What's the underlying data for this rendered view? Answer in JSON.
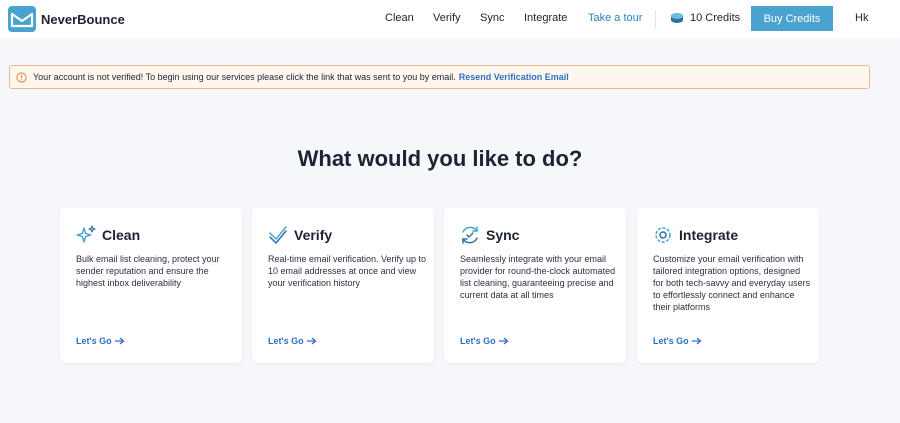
{
  "header": {
    "brand": "NeverBounce",
    "nav": {
      "clean": "Clean",
      "verify": "Verify",
      "sync": "Sync",
      "integrate": "Integrate",
      "tour": "Take a tour"
    },
    "credits": "10 Credits",
    "buy_credits": "Buy Credits",
    "avatar": "Hk"
  },
  "alert": {
    "message": "Your account is not verified! To begin using our services please click the link that was sent to you by email.",
    "link": "Resend Verification Email"
  },
  "main": {
    "heading": "What would you like to do?",
    "cards": [
      {
        "title": "Clean",
        "icon": "sparkle-icon",
        "description": "Bulk email list cleaning, protect your sender reputation and ensure the highest inbox deliverability",
        "link": "Let's Go"
      },
      {
        "title": "Verify",
        "icon": "verify-check-icon",
        "description": "Real-time email verification. Verify up to 10 email addresses at once and view your verification history",
        "link": "Let's Go"
      },
      {
        "title": "Sync",
        "icon": "sync-icon",
        "description": "Seamlessly integrate with your email provider for round-the-clock automated list cleaning, guaranteeing precise and current data at all times",
        "link": "Let's Go"
      },
      {
        "title": "Integrate",
        "icon": "gear-icon",
        "description": "Customize your email verification with tailored integration options, designed for both tech-savvy and everyday users to effortlessly connect and enhance their platforms",
        "link": "Let's Go"
      }
    ]
  },
  "colors": {
    "accent": "#4aa3cf",
    "link": "#2f6fc4",
    "background": "#f5f7fb",
    "alert_border": "#f1b98a"
  }
}
